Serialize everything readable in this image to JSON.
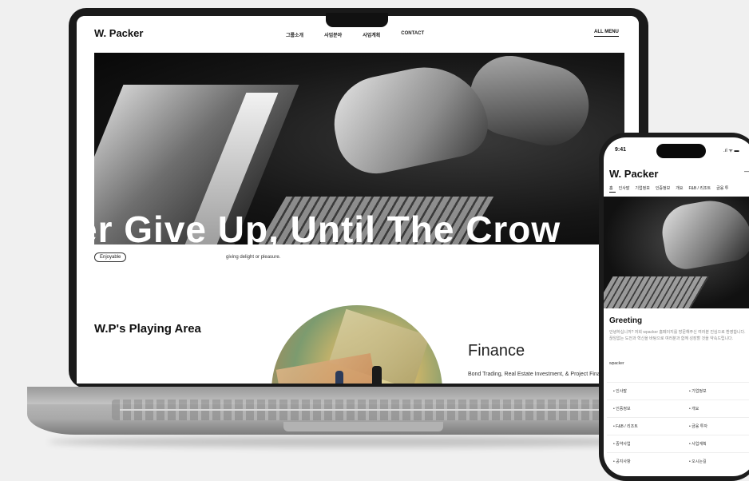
{
  "laptop_site": {
    "logo": "W. Packer",
    "nav": [
      "그룹소개",
      "사업분야",
      "사업계획",
      "CONTACT"
    ],
    "all_menu": "ALL MENU",
    "hero_text": "er Give Up, Until The Crow",
    "tag": "Enjoyable",
    "tagline": "giving delight or pleasure.",
    "area_title": "W.P's Playing Area",
    "finance_title": "Finance",
    "finance_desc": "Bond Trading, Real Estate Investment, & Project Finance"
  },
  "phone_site": {
    "time": "9:41",
    "status": ".ıl ᯤ ▬",
    "logo": "W. Packer",
    "menu_icon": "—",
    "nav": [
      "홈",
      "인사말",
      "기업정보",
      "인증정보",
      "개요",
      "F&B / 리조트",
      "금융 투"
    ],
    "greeting": "Greeting",
    "greeting_body": "안녕하십니까? 저희 wpacker 홈페이지를 방문해주신 여러분 진심으로 환영합니다. 끊임없는 도전과 혁신을 바탕으로 여러분과 함께 성장할 것을 약속드립니다.",
    "signature": "wpacker",
    "links": [
      "• 인사말",
      "• 기업정보",
      "• 인증정보",
      "• 개요",
      "• F&B / 리조트",
      "• 금융 투자",
      "• 중약사업",
      "• 사업계획",
      "• 공지사항",
      "• 오시는길"
    ]
  }
}
